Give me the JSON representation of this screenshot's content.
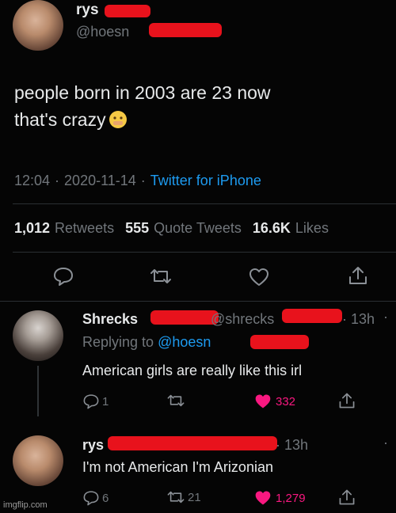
{
  "tweet": {
    "display_name": "rys",
    "handle": "@hoesn",
    "text_line1": "people born in 2003 are 23 now",
    "text_line2": "that's crazy",
    "time": "12:04",
    "date": "2020-11-14",
    "source": "Twitter for iPhone",
    "sep": "·",
    "stats": {
      "retweets_count": "1,012",
      "retweets_label": "Retweets",
      "quotes_count": "555",
      "quotes_label": "Quote Tweets",
      "likes_count": "16.6K",
      "likes_label": "Likes"
    },
    "emoji": "🫢"
  },
  "replies": [
    {
      "display_name": "Shrecks",
      "handle": "@shrecks",
      "time": "· 13h",
      "replying_prefix": "Replying to",
      "replying_to": "@hoesn",
      "text": "American girls are really like this irl",
      "reply_count": "1",
      "retweet_count": "",
      "like_count": "332",
      "more": "·"
    },
    {
      "display_name": "rys",
      "time": "· 13h",
      "text": "I'm not American I'm Arizonian",
      "reply_count": "6",
      "retweet_count": "21",
      "like_count": "1,279",
      "more": "·"
    }
  ],
  "watermark": "imgflip.com",
  "colors": {
    "accent": "#1d9bf0",
    "like": "#f91880",
    "redaction": "#e8121c"
  }
}
